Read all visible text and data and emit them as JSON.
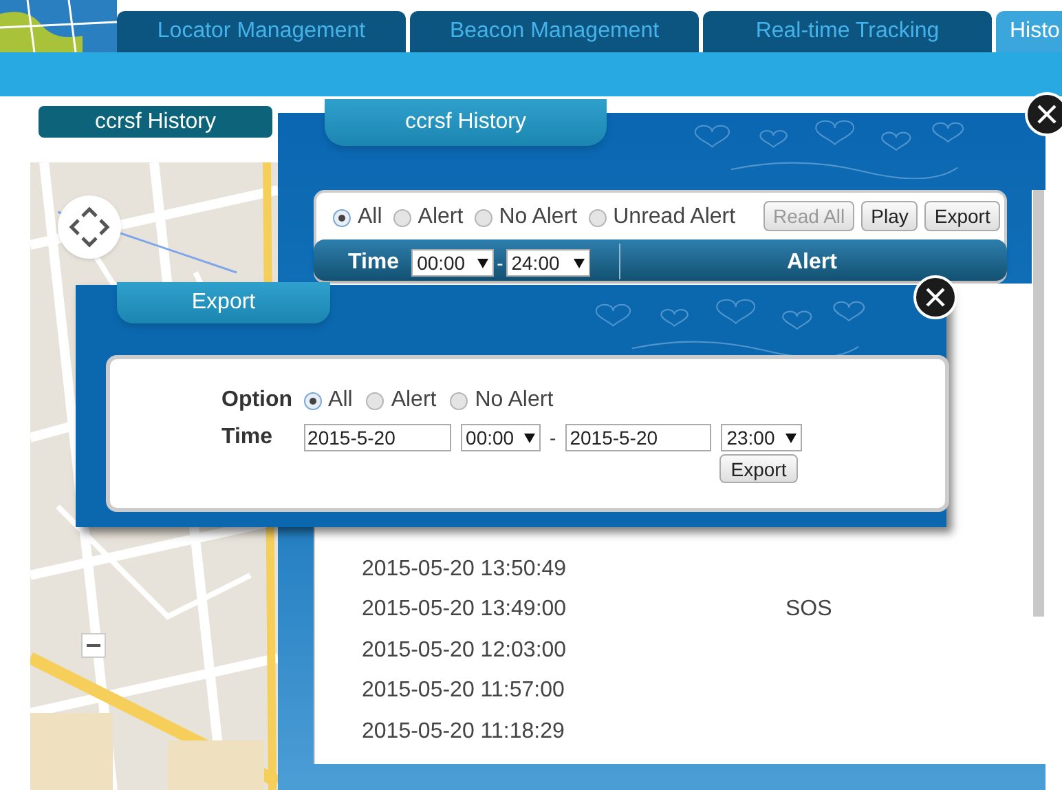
{
  "nav_tabs": [
    {
      "label": "Locator Management",
      "selected": false
    },
    {
      "label": "Beacon Management",
      "selected": false
    },
    {
      "label": "Real-time Tracking",
      "selected": false
    },
    {
      "label": "Histo",
      "selected": true
    }
  ],
  "side_panel": {
    "title": "ccrsf History"
  },
  "history_dialog": {
    "title": "ccrsf History",
    "filters": [
      {
        "label": "All",
        "selected": true
      },
      {
        "label": "Alert",
        "selected": false
      },
      {
        "label": "No Alert",
        "selected": false
      },
      {
        "label": "Unread Alert",
        "selected": false
      }
    ],
    "buttons": [
      {
        "label": "Read All",
        "disabled": true
      },
      {
        "label": "Play",
        "disabled": false
      },
      {
        "label": "Export",
        "disabled": false
      }
    ],
    "time_label": "Time",
    "time_from": "00:00",
    "separator": "-",
    "time_to": "24:00",
    "alert_header": "Alert",
    "rows": [
      {
        "time": "2015-05-20 13:50:49"
      },
      {
        "time": "2015-05-20 13:49:00",
        "alert": "SOS"
      },
      {
        "time": "2015-05-20 12:03:00"
      },
      {
        "time": "2015-05-20 11:57:00"
      },
      {
        "time": "2015-05-20 11:18:29"
      }
    ]
  },
  "export_dialog": {
    "title": "Export",
    "option_label": "Option",
    "options": [
      {
        "label": "All",
        "selected": true
      },
      {
        "label": "Alert",
        "selected": false
      },
      {
        "label": "No Alert",
        "selected": false
      }
    ],
    "time_label": "Time",
    "start_date": "2015-5-20",
    "start_time": "00:00",
    "separator": "-",
    "end_date": "2015-5-20",
    "end_time": "23:00",
    "button": "Export"
  }
}
